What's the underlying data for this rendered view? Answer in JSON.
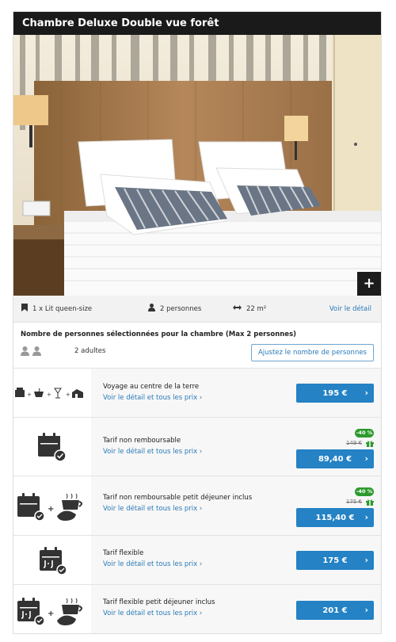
{
  "room": {
    "title": "Chambre Deluxe Double vue forêt",
    "zoom_label": "+"
  },
  "features": {
    "bed": "1 x Lit queen-size",
    "persons": "2 personnes",
    "size": "22 m²",
    "detail_link": "Voir le détail"
  },
  "persons": {
    "title": "Nombre de personnes sélectionnées pour la chambre (Max 2 personnes)",
    "count": "2 adultes",
    "adjust_button": "Ajustez le nombre de personnes"
  },
  "rates": [
    {
      "name": "Voyage au centre de la terre",
      "link": "Voir le détail et tous les prix ›",
      "price": "195 €",
      "icon": "travel-package-icon"
    },
    {
      "name": "Tarif non remboursable",
      "link": "Voir le détail et tous les prix ›",
      "price": "89,40 €",
      "old_price": "149 €",
      "discount": "-40 %",
      "icon": "calendar-check-icon"
    },
    {
      "name": "Tarif non remboursable petit déjeuner inclus",
      "link": "Voir le détail et tous les prix ›",
      "price": "115,40 €",
      "old_price": "175 €",
      "discount": "-40 %",
      "icon": "calendar-breakfast-icon"
    },
    {
      "name": "Tarif flexible",
      "link": "Voir le détail et tous les prix ›",
      "price": "175 €",
      "icon": "calendar-flexible-icon"
    },
    {
      "name": "Tarif flexible petit déjeuner inclus",
      "link": "Voir le détail et tous les prix ›",
      "price": "201 €",
      "icon": "calendar-flexible-breakfast-icon"
    }
  ],
  "colors": {
    "accent": "#2482c5",
    "discount": "#2d9a2e",
    "header": "#1a1a1a"
  }
}
